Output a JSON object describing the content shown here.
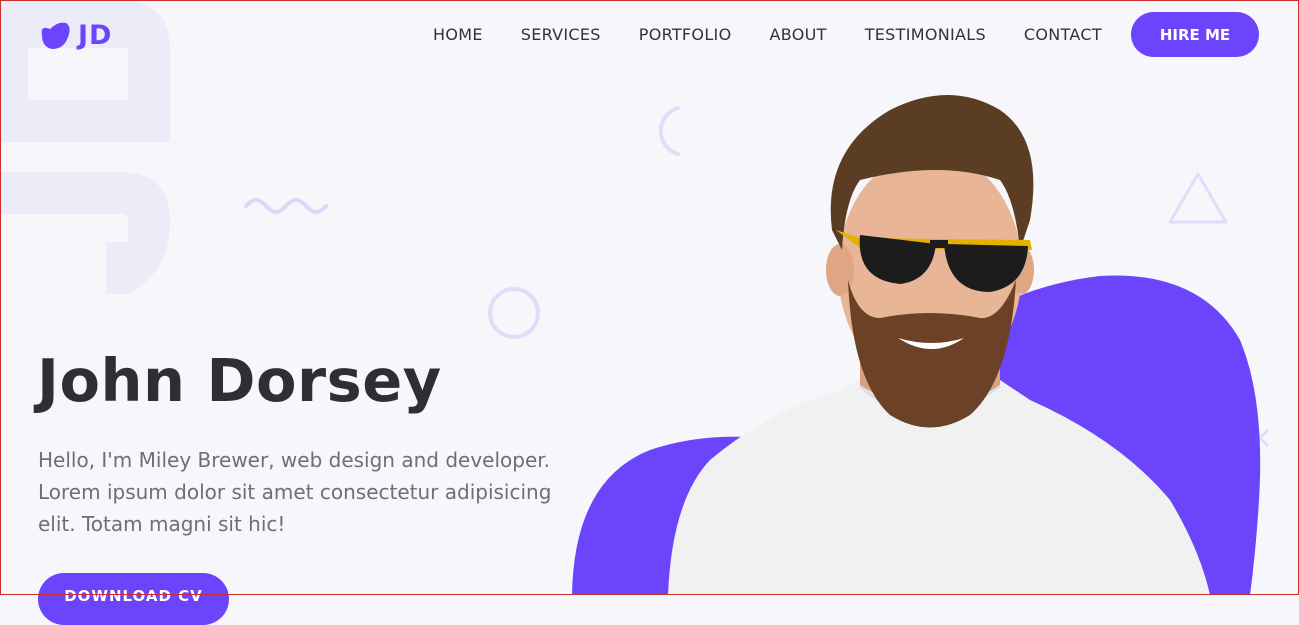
{
  "header": {
    "logo_text": "JD",
    "nav": [
      "HOME",
      "SERVICES",
      "PORTFOLIO",
      "ABOUT",
      "TESTIMONIALS",
      "CONTACT"
    ],
    "cta_label": "HIRE ME"
  },
  "hero": {
    "name": "John Dorsey",
    "description": "Hello, I'm Miley Brewer, web design and developer. Lorem ipsum dolor sit amet consectetur adipisicing elit. Totam magni sit hic!",
    "download_label": "DOWNLOAD CV"
  },
  "colors": {
    "accent": "#6c44fc",
    "background": "#f6f6fb",
    "heading": "#2f2f33",
    "body_text": "#6e6e78",
    "decor": "#e6e2fb"
  },
  "icons": [
    "logo-blob-icon",
    "squiggle-icon",
    "ring-icon",
    "arc-icon",
    "triangle-icon",
    "x-mark-icon"
  ]
}
